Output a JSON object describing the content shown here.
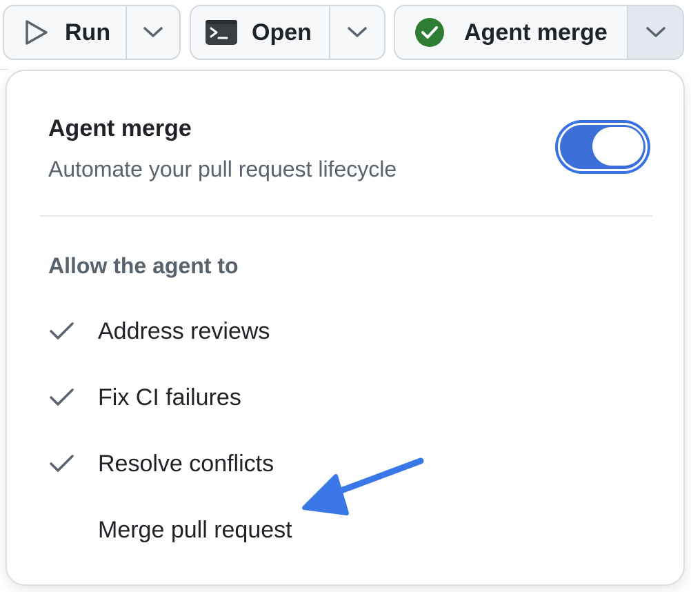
{
  "toolbar": {
    "run": {
      "label": "Run",
      "icon": "play-icon",
      "menu_icon": "chevron-down-icon"
    },
    "open": {
      "label": "Open",
      "icon": "terminal-icon",
      "menu_icon": "chevron-down-icon"
    },
    "agent_merge": {
      "label": "Agent merge",
      "icon": "check-circle-icon",
      "status_color": "#2e7d32",
      "menu_icon": "chevron-down-icon",
      "menu_expanded": true
    }
  },
  "panel": {
    "title": "Agent merge",
    "subtitle": "Automate your pull request lifecycle",
    "toggle": {
      "on": true,
      "color": "#3d6fd8"
    },
    "section_heading": "Allow the agent to",
    "options": [
      {
        "label": "Address reviews",
        "checked": true
      },
      {
        "label": "Fix CI failures",
        "checked": true
      },
      {
        "label": "Resolve conflicts",
        "checked": true
      },
      {
        "label": "Merge pull request",
        "checked": false
      }
    ]
  },
  "annotation": {
    "type": "arrow",
    "color": "#3b78e7",
    "target": "Merge pull request"
  }
}
